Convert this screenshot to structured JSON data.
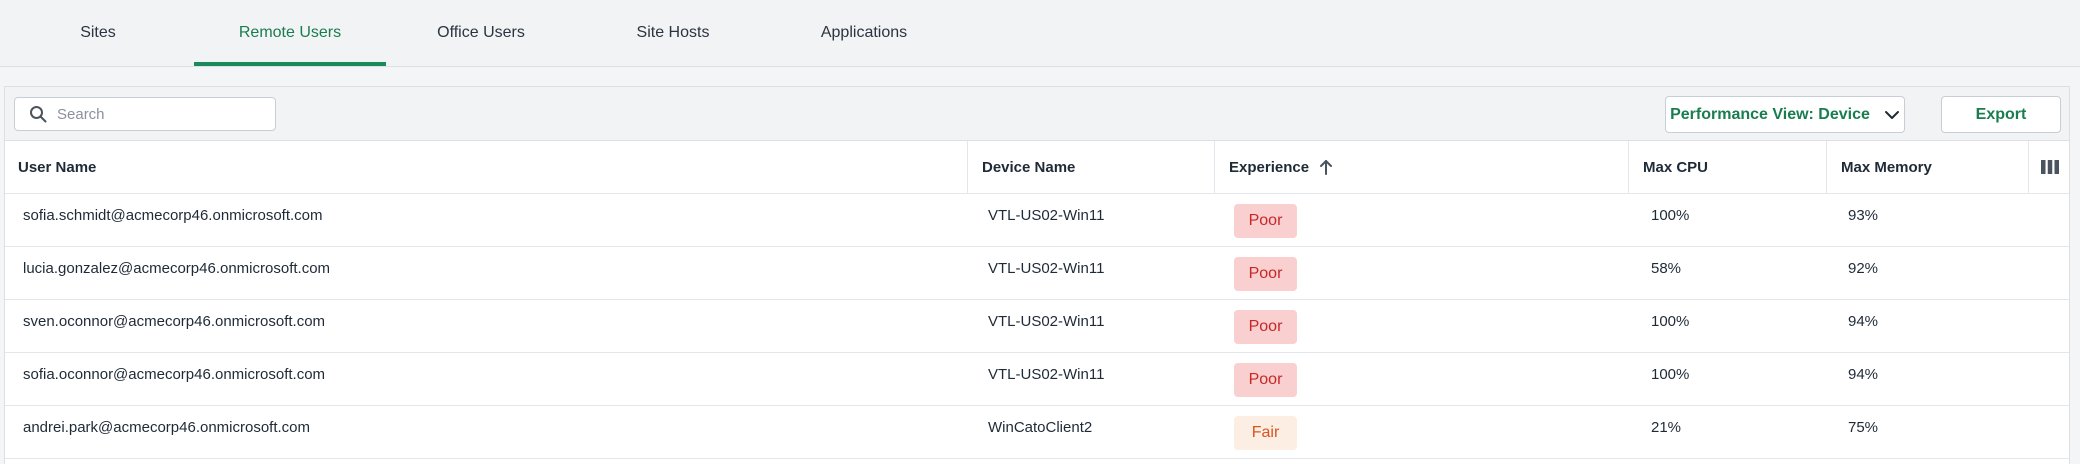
{
  "tabs": [
    {
      "label": "Sites",
      "active": false
    },
    {
      "label": "Remote Users",
      "active": true
    },
    {
      "label": "Office Users",
      "active": false
    },
    {
      "label": "Site Hosts",
      "active": false
    },
    {
      "label": "Applications",
      "active": false
    }
  ],
  "toolbar": {
    "search_placeholder": "Search",
    "search_value": "",
    "performance_view_label": "Performance View: Device",
    "export_label": "Export"
  },
  "table": {
    "columns": {
      "user_name": "User Name",
      "device_name": "Device Name",
      "experience": "Experience",
      "max_cpu": "Max CPU",
      "max_memory": "Max Memory"
    },
    "sort": {
      "column": "experience",
      "direction": "ascending",
      "icon": "arrow-up-icon"
    },
    "rows": [
      {
        "user": "sofia.schmidt@acmecorp46.onmicrosoft.com",
        "device": "VTL-US02-Win11",
        "experience": "Poor",
        "cpu": "100%",
        "memory": "93%"
      },
      {
        "user": "lucia.gonzalez@acmecorp46.onmicrosoft.com",
        "device": "VTL-US02-Win11",
        "experience": "Poor",
        "cpu": "58%",
        "memory": "92%"
      },
      {
        "user": "sven.oconnor@acmecorp46.onmicrosoft.com",
        "device": "VTL-US02-Win11",
        "experience": "Poor",
        "cpu": "100%",
        "memory": "94%"
      },
      {
        "user": "sofia.oconnor@acmecorp46.onmicrosoft.com",
        "device": "VTL-US02-Win11",
        "experience": "Poor",
        "cpu": "100%",
        "memory": "94%"
      },
      {
        "user": "andrei.park@acmecorp46.onmicrosoft.com",
        "device": "WinCatoClient2",
        "experience": "Fair",
        "cpu": "21%",
        "memory": "75%"
      }
    ]
  },
  "colors": {
    "accent": "#1a7d50",
    "poor_bg": "#f9cfcf",
    "poor_text": "#c62828",
    "fair_bg": "#fdeee4",
    "fair_text": "#d9541e"
  },
  "icons": {
    "search": "search-icon",
    "dropdown": "chevron-down-icon",
    "columns": "columns-icon"
  }
}
